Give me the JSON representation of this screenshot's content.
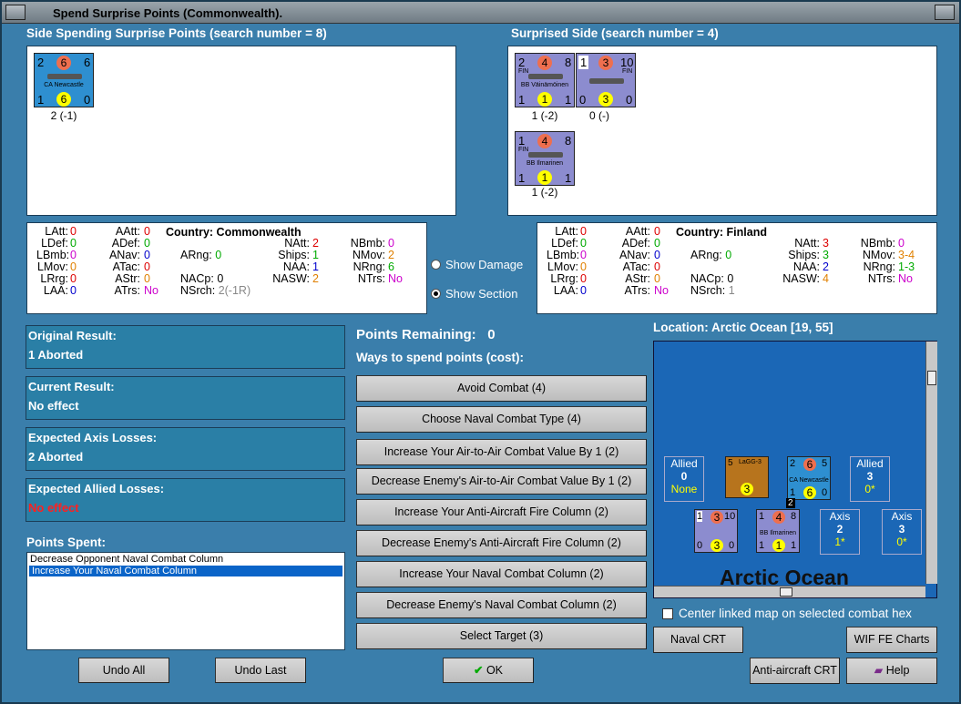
{
  "window": {
    "title": "Spend Surprise Points (Commonwealth)."
  },
  "left_side": {
    "header": "Side Spending Surprise Points (search number = 8)",
    "units": [
      {
        "tl": "2",
        "tm": "6",
        "tr": "6",
        "label": "CA Newcastle",
        "bl": "1",
        "bm": "6",
        "br": "0",
        "sub": "2 (-1)"
      }
    ]
  },
  "right_side": {
    "header": "Surprised Side (search number = 4)",
    "units": [
      {
        "tl": "2",
        "tm": "4",
        "tr": "8",
        "nat": "FIN",
        "label": "BB Väinämöinen",
        "bl": "1",
        "bm": "1",
        "br": "1",
        "sub": "1 (-2)"
      },
      {
        "tl": "1",
        "tm": "3",
        "tr": "10",
        "nat": "FIN",
        "label": "",
        "bl": "0",
        "bm": "3",
        "br": "0",
        "sub": "0 (-)"
      },
      {
        "tl": "1",
        "tm": "4",
        "tr": "8",
        "nat": "FIN",
        "label": "BB Ilmarinen",
        "bl": "1",
        "bm": "1",
        "br": "1",
        "sub": "1 (-2)"
      }
    ]
  },
  "left_stats": {
    "country": "Country: Commonwealth",
    "c1": [
      [
        "LAtt:",
        "0"
      ],
      [
        "LDef:",
        "0"
      ],
      [
        "LBmb:",
        "0"
      ],
      [
        "LMov:",
        "0"
      ],
      [
        "LRrg:",
        "0"
      ],
      [
        "LAA:",
        "0"
      ]
    ],
    "c2": [
      [
        "AAtt:",
        "0"
      ],
      [
        "ADef:",
        "0"
      ],
      [
        "ANav:",
        "0"
      ],
      [
        "ATac:",
        "0"
      ],
      [
        "AStr:",
        "0"
      ],
      [
        "ATrs:",
        "No"
      ]
    ],
    "c3": [
      [
        "ARng:",
        "0"
      ],
      [
        "NACp:",
        "0"
      ],
      [
        "NSrch:",
        "2(-1R)"
      ]
    ],
    "c4": [
      [
        "NAtt:",
        "2"
      ],
      [
        "Ships:",
        "1"
      ],
      [
        "NAA:",
        "1"
      ],
      [
        "NASW:",
        "2"
      ]
    ],
    "c5": [
      [
        "NBmb:",
        "0"
      ],
      [
        "NMov:",
        "2"
      ],
      [
        "NRng:",
        "6"
      ],
      [
        "NTrs:",
        "No"
      ]
    ]
  },
  "right_stats": {
    "country": "Country: Finland",
    "c1": [
      [
        "LAtt:",
        "0"
      ],
      [
        "LDef:",
        "0"
      ],
      [
        "LBmb:",
        "0"
      ],
      [
        "LMov:",
        "0"
      ],
      [
        "LRrg:",
        "0"
      ],
      [
        "LAA:",
        "0"
      ]
    ],
    "c2": [
      [
        "AAtt:",
        "0"
      ],
      [
        "ADef:",
        "0"
      ],
      [
        "ANav:",
        "0"
      ],
      [
        "ATac:",
        "0"
      ],
      [
        "AStr:",
        "0"
      ],
      [
        "ATrs:",
        "No"
      ]
    ],
    "c3": [
      [
        "ARng:",
        "0"
      ],
      [
        "NACp:",
        "0"
      ],
      [
        "NSrch:",
        "1"
      ]
    ],
    "c4": [
      [
        "NAtt:",
        "3"
      ],
      [
        "Ships:",
        "3"
      ],
      [
        "NAA:",
        "2"
      ],
      [
        "NASW:",
        "4"
      ]
    ],
    "c5": [
      [
        "NBmb:",
        "0"
      ],
      [
        "NMov:",
        "3-4"
      ],
      [
        "NRng:",
        "1-3"
      ],
      [
        "NTrs:",
        "No"
      ]
    ]
  },
  "radios": {
    "damage": "Show Damage",
    "section": "Show Section"
  },
  "results": {
    "original_label": "Original Result:",
    "original_value": "1 Aborted",
    "current_label": "Current Result:",
    "current_value": "No effect",
    "axis_label": "Expected Axis Losses:",
    "axis_value": "2 Aborted",
    "allied_label": "Expected Allied Losses:",
    "allied_value": "No effect"
  },
  "points_spent": {
    "label": "Points Spent:",
    "items": [
      "Decrease Opponent Naval Combat Column",
      "Increase Your Naval Combat Column"
    ]
  },
  "spend": {
    "remaining_label": "Points Remaining:",
    "remaining_value": "0",
    "ways_label": "Ways to spend points (cost):",
    "options": [
      "Avoid Combat (4)",
      "Choose Naval Combat Type (4)",
      "Increase Your Air-to-Air Combat Value By 1 (2)",
      "Decrease Enemy's Air-to-Air Combat Value By 1 (2)",
      "Increase Your Anti-Aircraft Fire Column (2)",
      "Decrease Enemy's Anti-Aircraft Fire Column (2)",
      "Increase Your Naval Combat Column (2)",
      "Decrease Enemy's Naval Combat Column (2)",
      "Select Target (3)"
    ]
  },
  "map": {
    "location": "Location: Arctic Ocean [19, 55]",
    "sea_name": "Arctic Ocean",
    "allied1": {
      "title": "Allied",
      "num": "0",
      "sub": "None"
    },
    "allied2": {
      "title": "Allied",
      "num": "3",
      "sub": "0*"
    },
    "axis1": {
      "title": "Axis",
      "num": "2",
      "sub": "1*"
    },
    "axis2": {
      "title": "Axis",
      "num": "3",
      "sub": "0*"
    },
    "air_unit": {
      "label": "LaGG-3",
      "tl": "5",
      "bm": "3"
    },
    "map_units": [
      {
        "tl": "2",
        "tm": "6",
        "tr": "5",
        "label": "CA Newcastle",
        "bl": "1",
        "bm": "6",
        "br": "0"
      },
      {
        "tl": "1",
        "tm": "3",
        "tr": "10",
        "bl": "0",
        "bm": "3",
        "br": "0"
      },
      {
        "tl": "1",
        "tm": "4",
        "tr": "8",
        "label": "BB Ilmarinen",
        "bl": "1",
        "bm": "1",
        "br": "1"
      }
    ],
    "stack_count": "2",
    "center_checkbox": "Center linked map on selected combat hex"
  },
  "buttons": {
    "undo_all": "Undo All",
    "undo_last": "Undo Last",
    "ok": "OK",
    "naval_crt": "Naval CRT",
    "wif_fe": "WIF FE Charts",
    "aa_crt": "Anti-aircraft CRT",
    "help": "Help"
  }
}
